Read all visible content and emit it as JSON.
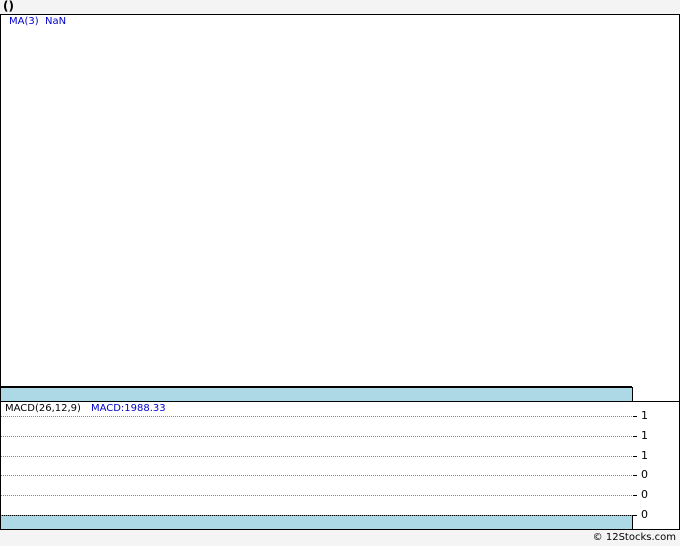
{
  "title": "()",
  "price_panel": {
    "ma_legend": "MA(3)  NaN"
  },
  "macd_panel": {
    "indicator": "MACD(26,12,9)",
    "value_text": "MACD:1988.33"
  },
  "footer": "© 12Stocks.com",
  "colors": {
    "strip": "#add8e6",
    "legend_blue": "#0000cc",
    "grid": "#888888"
  },
  "chart_data": [
    {
      "type": "line",
      "title": "()",
      "legend": [
        "MA(3)  NaN"
      ],
      "series": []
    },
    {
      "type": "line",
      "title": "MACD(26,12,9)",
      "legend": [
        "MACD:1988.33"
      ],
      "y_tick_labels": [
        "1",
        "1",
        "1",
        "0",
        "0",
        "0"
      ],
      "grid": true,
      "series": []
    }
  ]
}
